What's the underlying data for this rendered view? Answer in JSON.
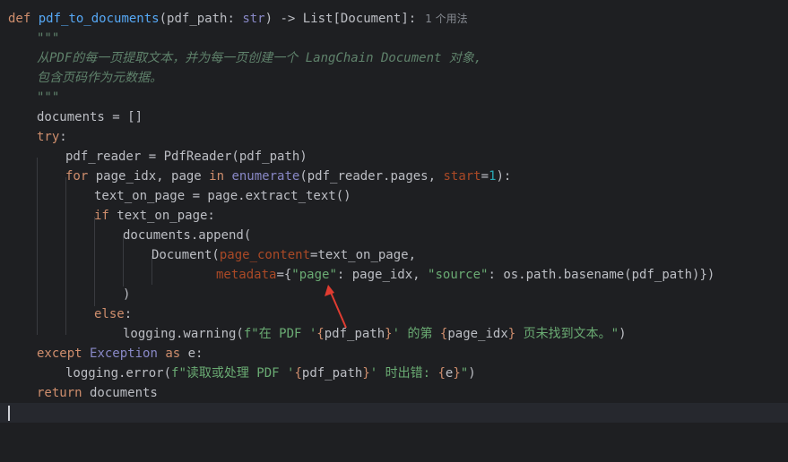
{
  "editor": {
    "usage_hint": "1 个用法",
    "lines": {
      "l1": {
        "def": "def",
        "name": "pdf_to_documents",
        "open": "(",
        "param": "pdf_path",
        "colon": ": ",
        "type": "str",
        "rest": ") -> List[Document]:"
      },
      "l2": "\"\"\"",
      "l3": "从PDF的每一页提取文本，并为每一页创建一个 LangChain Document 对象,",
      "l4": "包含页码作为元数据。",
      "l5": "\"\"\"",
      "l6": "documents = []",
      "l7": {
        "kw": "try",
        "rest": ":"
      },
      "l8": "pdf_reader = PdfReader(pdf_path)",
      "l9": {
        "for": "for",
        "a": " page_idx, page ",
        "in": "in",
        "sp": " ",
        "enum": "enumerate",
        "b": "(pdf_reader.pages, ",
        "kwarg": "start",
        "eq": "=",
        "num": "1",
        "c": "):"
      },
      "l10": "text_on_page = page.extract_text()",
      "l11": {
        "kw": "if",
        "rest": " text_on_page:"
      },
      "l12": "documents.append(",
      "l13": {
        "a": "Document(",
        "kwarg": "page_content",
        "b": "=text_on_page,"
      },
      "l14": {
        "kwarg": "metadata",
        "a": "={",
        "s1": "\"page\"",
        "b": ": page_idx, ",
        "s2": "\"source\"",
        "c": ": os.path.basename(pdf_path)})"
      },
      "l15": ")",
      "l16": {
        "kw": "else",
        "rest": ":"
      },
      "l17": {
        "a": "logging.warning(",
        "s1": "f\"在 PDF '",
        "lb1": "{",
        "v1": "pdf_path",
        "rb1": "}",
        "s2": "' 的第 ",
        "lb2": "{",
        "v2": "page_idx",
        "rb2": "}",
        "s3": " 页未找到文本。\"",
        "b": ")"
      },
      "l18": {
        "kw": "except",
        "sp": " ",
        "exc": "Exception",
        "sp2": " ",
        "as": "as",
        "rest": " e:"
      },
      "l19": {
        "a": "logging.error(",
        "s1": "f\"读取或处理 PDF '",
        "lb1": "{",
        "v1": "pdf_path",
        "rb1": "}",
        "s2": "' 时出错: ",
        "lb2": "{",
        "v2": "e",
        "rb2": "}",
        "s3": "\"",
        "b": ")"
      },
      "l20": {
        "kw": "return",
        "rest": " documents"
      }
    }
  },
  "colors": {
    "background": "#1e1f22",
    "keyword": "#cf8e6d",
    "function": "#56a8f5",
    "string": "#6aab73",
    "docstring": "#5f826b",
    "number": "#2aacb8",
    "arrow": "#e03c31"
  },
  "annotation": {
    "arrow_icon": "red-arrow-icon"
  }
}
